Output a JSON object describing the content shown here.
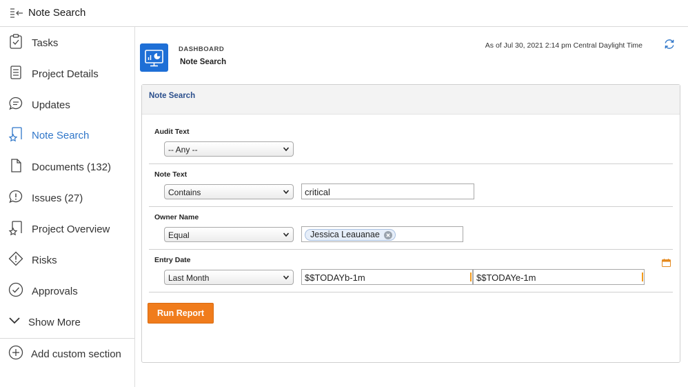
{
  "app": {
    "title": "Note Search"
  },
  "sidebar": {
    "items": [
      {
        "label": "Tasks"
      },
      {
        "label": "Project Details"
      },
      {
        "label": "Updates"
      },
      {
        "label": "Note Search",
        "active": true
      },
      {
        "label": "Documents (132)"
      },
      {
        "label": "Issues (27)"
      },
      {
        "label": "Project Overview"
      },
      {
        "label": "Risks"
      },
      {
        "label": "Approvals"
      },
      {
        "label": "Show More"
      }
    ],
    "add_section_label": "Add custom section"
  },
  "header": {
    "kicker": "DASHBOARD",
    "title": "Note Search",
    "as_of": "As of  Jul 30, 2021 2:14 pm Central Daylight Time"
  },
  "panel": {
    "title": "Note Search",
    "fields": {
      "audit_text": {
        "label": "Audit Text",
        "operator": "-- Any --"
      },
      "note_text": {
        "label": "Note Text",
        "operator": "Contains",
        "value": "critical"
      },
      "owner_name": {
        "label": "Owner Name",
        "operator": "Equal",
        "chip": "Jessica Leauanae"
      },
      "entry_date": {
        "label": "Entry Date",
        "operator": "Last Month",
        "from": "$$TODAYb-1m",
        "to": "$$TODAYe-1m"
      }
    },
    "run_label": "Run Report"
  },
  "colors": {
    "accent": "#2f76c9",
    "run_button": "#f07c1c",
    "dashboard_icon": "#1e6fd6",
    "panel_title": "#2a4e8c"
  }
}
